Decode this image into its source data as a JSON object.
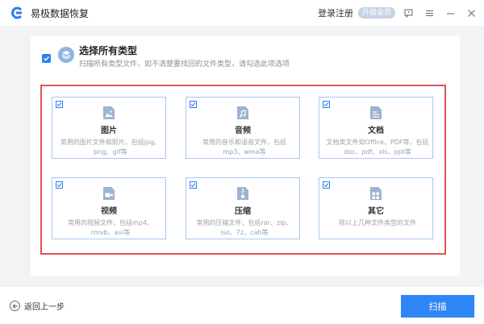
{
  "app": {
    "title": "易极数据恢复",
    "logo_icon": "app-logo-icon",
    "accent_color": "#2f86f6"
  },
  "topbar": {
    "login_label": "登录注册",
    "upgrade_label": "升级会员",
    "icons": [
      "feedback-icon",
      "menu-icon",
      "minimize-icon",
      "close-icon"
    ]
  },
  "select_all": {
    "checked": true,
    "title": "选择所有类型",
    "subtitle": "扫描所有类型文件，如不清楚要找回的文件类型，请勾选此项选项"
  },
  "file_types": [
    {
      "name": "图片",
      "desc": "常用的图片文件和照片，包括jpg、png、gif等",
      "icon": "image-icon",
      "checked": true
    },
    {
      "name": "音频",
      "desc": "常用的音乐和语音文件，包括mp3、wma等",
      "icon": "audio-icon",
      "checked": true
    },
    {
      "name": "文档",
      "desc": "文档类文件如Office、PDF等，包括doc、pdf、xls、ppt等",
      "icon": "document-icon",
      "checked": true
    },
    {
      "name": "视频",
      "desc": "常用的视频文件，包括mp4、rmvb、avi等",
      "icon": "video-icon",
      "checked": true
    },
    {
      "name": "压缩",
      "desc": "常用的压缩文件，包括rar、zip、iso、7z、cab等",
      "icon": "archive-icon",
      "checked": true
    },
    {
      "name": "其它",
      "desc": "除以上几种文件类型的文件",
      "icon": "other-icon",
      "checked": true
    }
  ],
  "footer": {
    "back_label": "返回上一步",
    "scan_label": "扫描"
  }
}
